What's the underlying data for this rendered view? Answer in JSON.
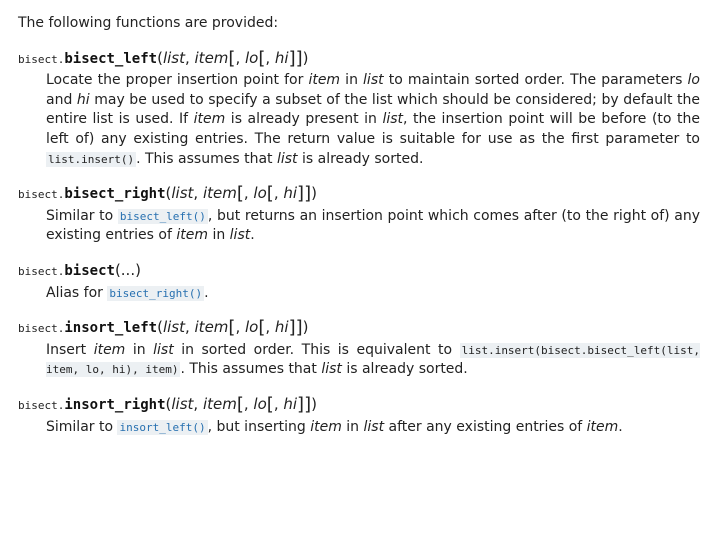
{
  "intro": "The following functions are provided:",
  "module": "bisect",
  "functions": [
    {
      "name": "bisect_left",
      "params_html": "(<span class=\"param\">list</span>, <span class=\"param\">item</span><span class=\"opt\">[</span>, <span class=\"param\">lo</span><span class=\"opt\">[</span>, <span class=\"param\">hi</span><span class=\"opt\">]]</span>)",
      "desc_html": "Locate the proper insertion point for <em>item</em> in <em>list</em> to maintain sorted order. The parameters <em>lo</em> and <em>hi</em> may be used to specify a subset of the list which should be considered; by default the entire list is used. If <em>item</em> is already present in <em>list</em>, the insertion point will be before (to the left of) any existing entries. The return value is suitable for use as the first parameter to <span class=\"lit\">list.insert()</span>. This assumes that <em>list</em> is already sorted."
    },
    {
      "name": "bisect_right",
      "params_html": "(<span class=\"param\">list</span>, <span class=\"param\">item</span><span class=\"opt\">[</span>, <span class=\"param\">lo</span><span class=\"opt\">[</span>, <span class=\"param\">hi</span><span class=\"opt\">]]</span>)",
      "desc_html": "Similar to <a class=\"xref\" data-name=\"link-bisect-left\" data-interactable=\"true\">bisect_left()</a>, but returns an insertion point which comes after (to the right of) any existing entries of <em>item</em> in <em>list</em>."
    },
    {
      "name": "bisect",
      "params_html": "(...)",
      "desc_html": "Alias for <a class=\"xref\" data-name=\"link-bisect-right\" data-interactable=\"true\">bisect_right()</a>."
    },
    {
      "name": "insort_left",
      "params_html": "(<span class=\"param\">list</span>, <span class=\"param\">item</span><span class=\"opt\">[</span>, <span class=\"param\">lo</span><span class=\"opt\">[</span>, <span class=\"param\">hi</span><span class=\"opt\">]]</span>)",
      "desc_html": "Insert <em>item</em> in <em>list</em> in sorted order. This is equivalent to <span class=\"lit\">list.insert(bisect.bisect_left(list, item, lo, hi), item)</span>. This assumes that <em>list</em> is already sorted."
    },
    {
      "name": "insort_right",
      "params_html": "(<span class=\"param\">list</span>, <span class=\"param\">item</span><span class=\"opt\">[</span>, <span class=\"param\">lo</span><span class=\"opt\">[</span>, <span class=\"param\">hi</span><span class=\"opt\">]]</span>)",
      "desc_html": "Similar to <a class=\"xref\" data-name=\"link-insort-left\" data-interactable=\"true\">insort_left()</a>, but inserting <em>item</em> in <em>list</em> after any existing entries of <em>item</em>."
    }
  ]
}
